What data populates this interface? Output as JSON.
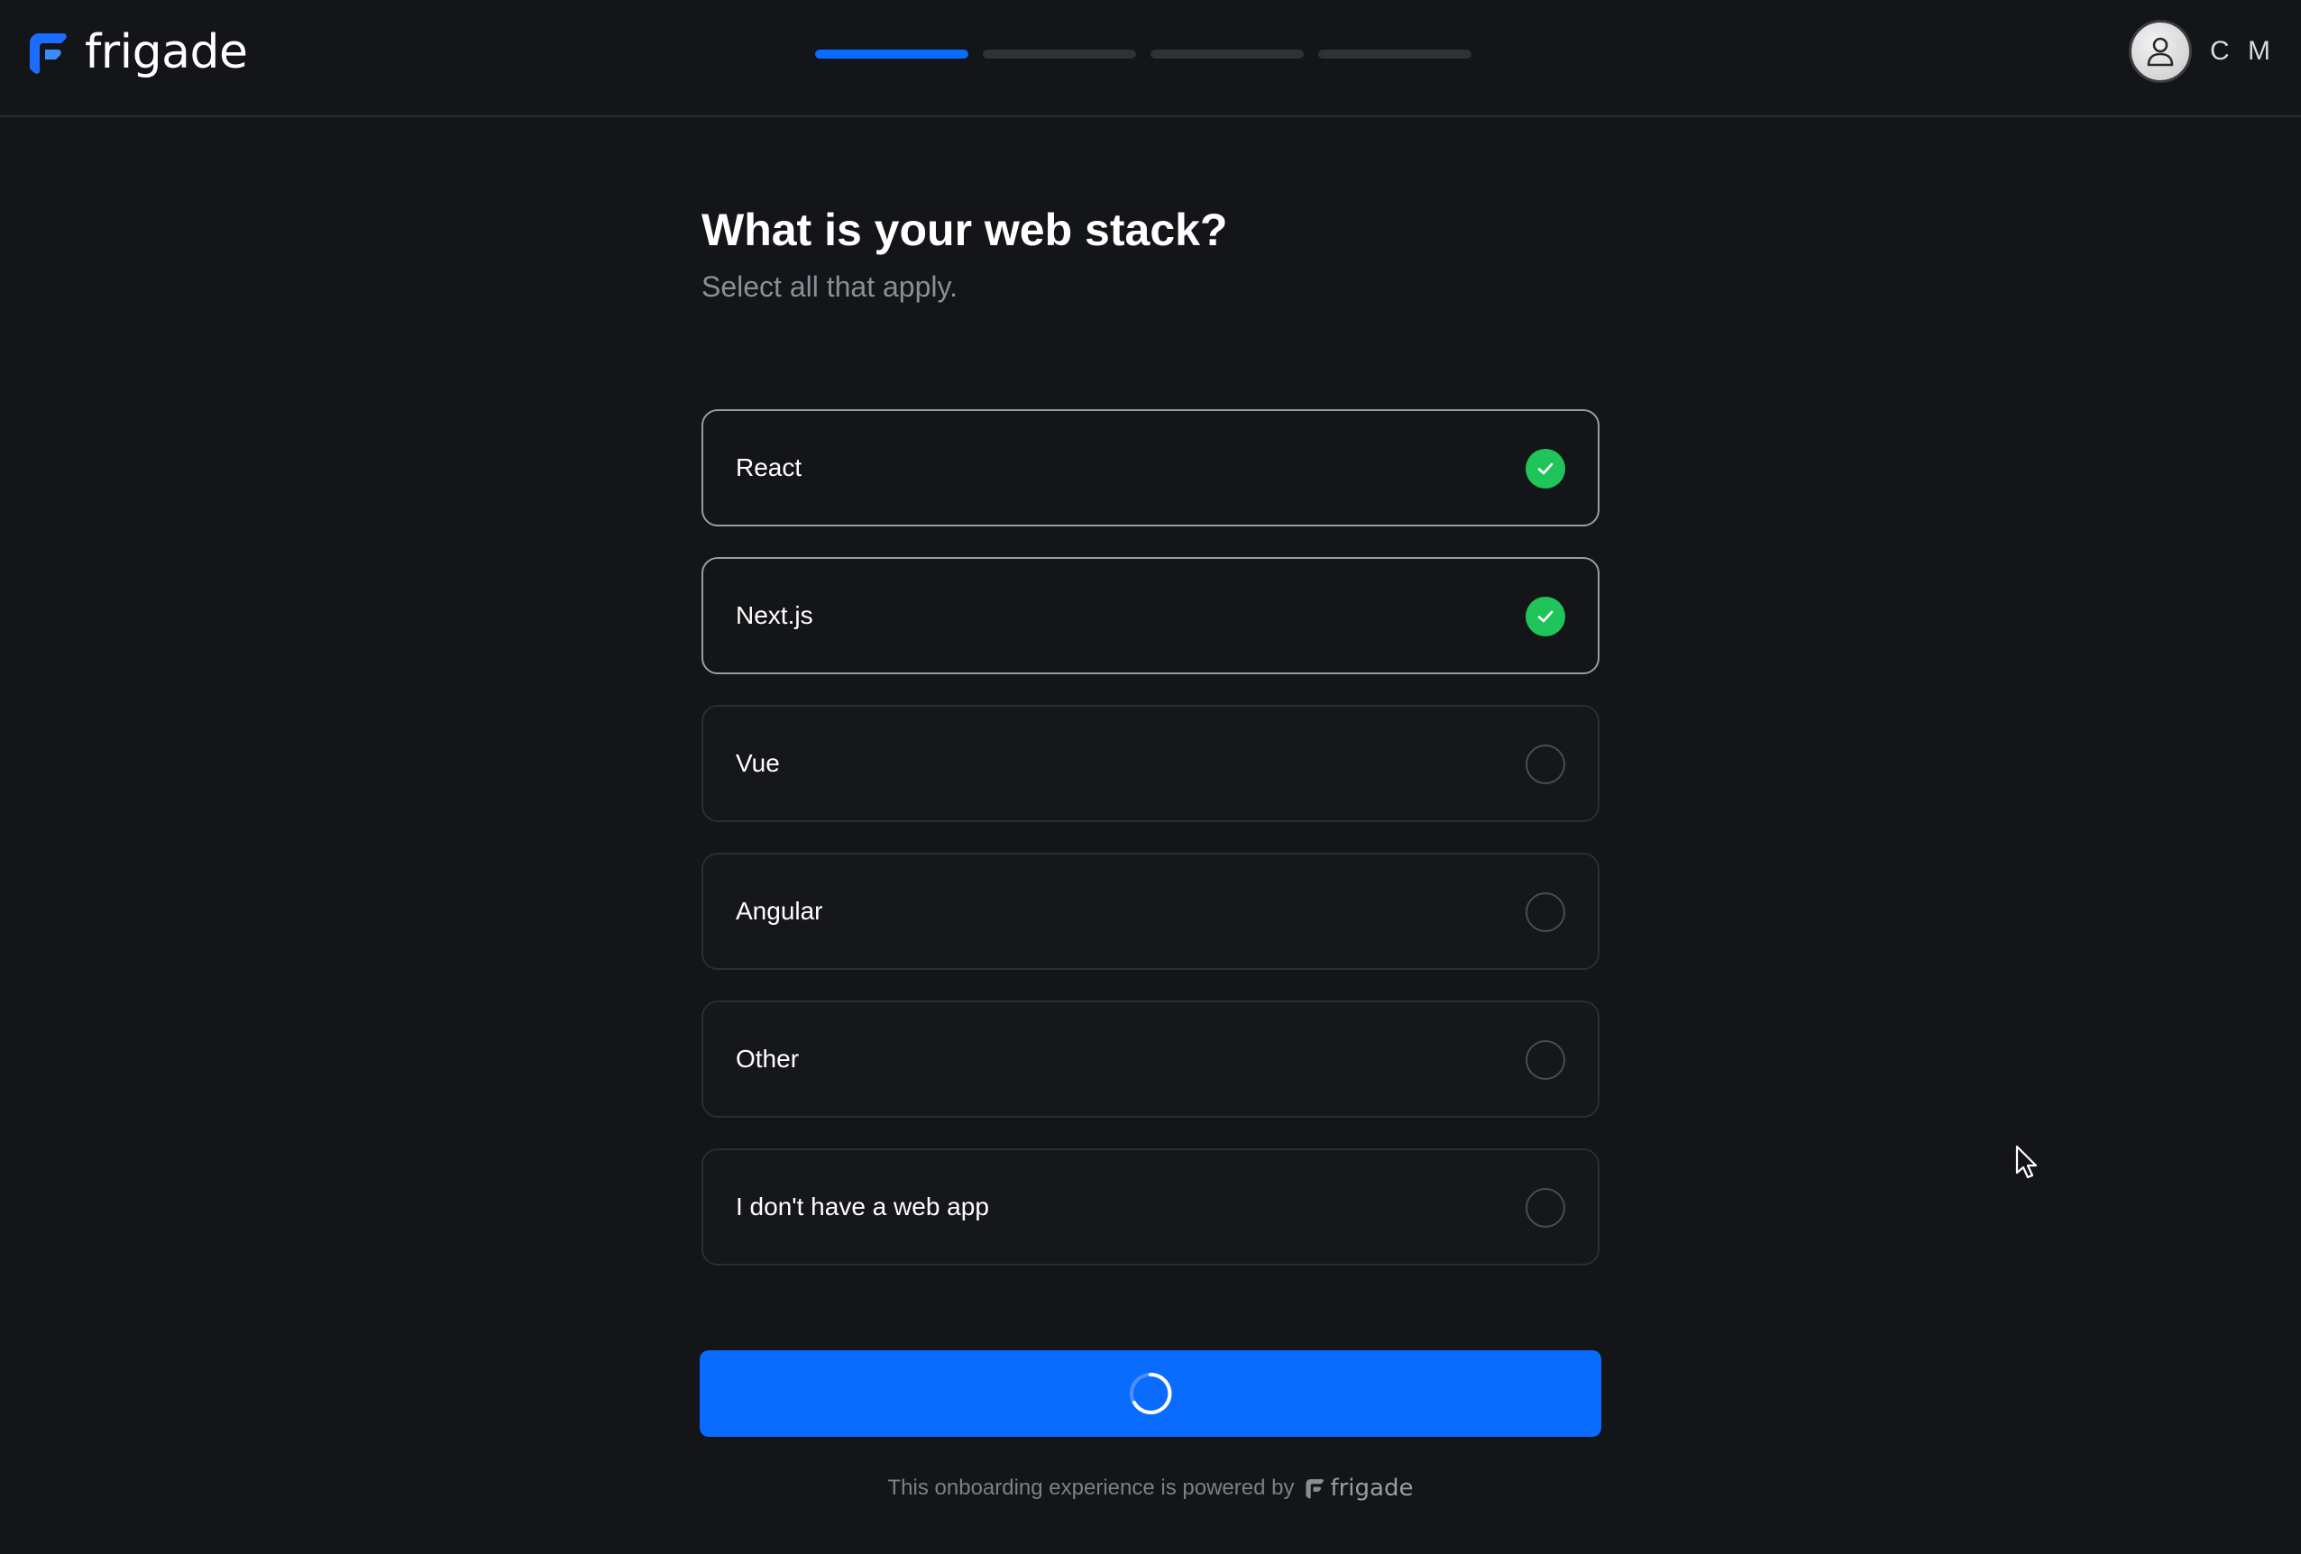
{
  "header": {
    "brand_name": "frigade",
    "progress": {
      "total_steps": 4,
      "current_step": 1
    },
    "user": {
      "initials": "C M"
    }
  },
  "question": {
    "title": "What is your web stack?",
    "subtitle": "Select all that apply."
  },
  "options": [
    {
      "label": "React",
      "selected": true
    },
    {
      "label": "Next.js",
      "selected": true
    },
    {
      "label": "Vue",
      "selected": false
    },
    {
      "label": "Angular",
      "selected": false
    },
    {
      "label": "Other",
      "selected": false
    },
    {
      "label": "I don't have a web app",
      "selected": false
    }
  ],
  "submit": {
    "state": "loading",
    "icon": "spinner-icon"
  },
  "footer": {
    "text": "This onboarding experience is powered by",
    "brand_name": "frigade"
  },
  "colors": {
    "background": "#141518",
    "accent": "#0a6bff",
    "check": "#1fc45a"
  }
}
